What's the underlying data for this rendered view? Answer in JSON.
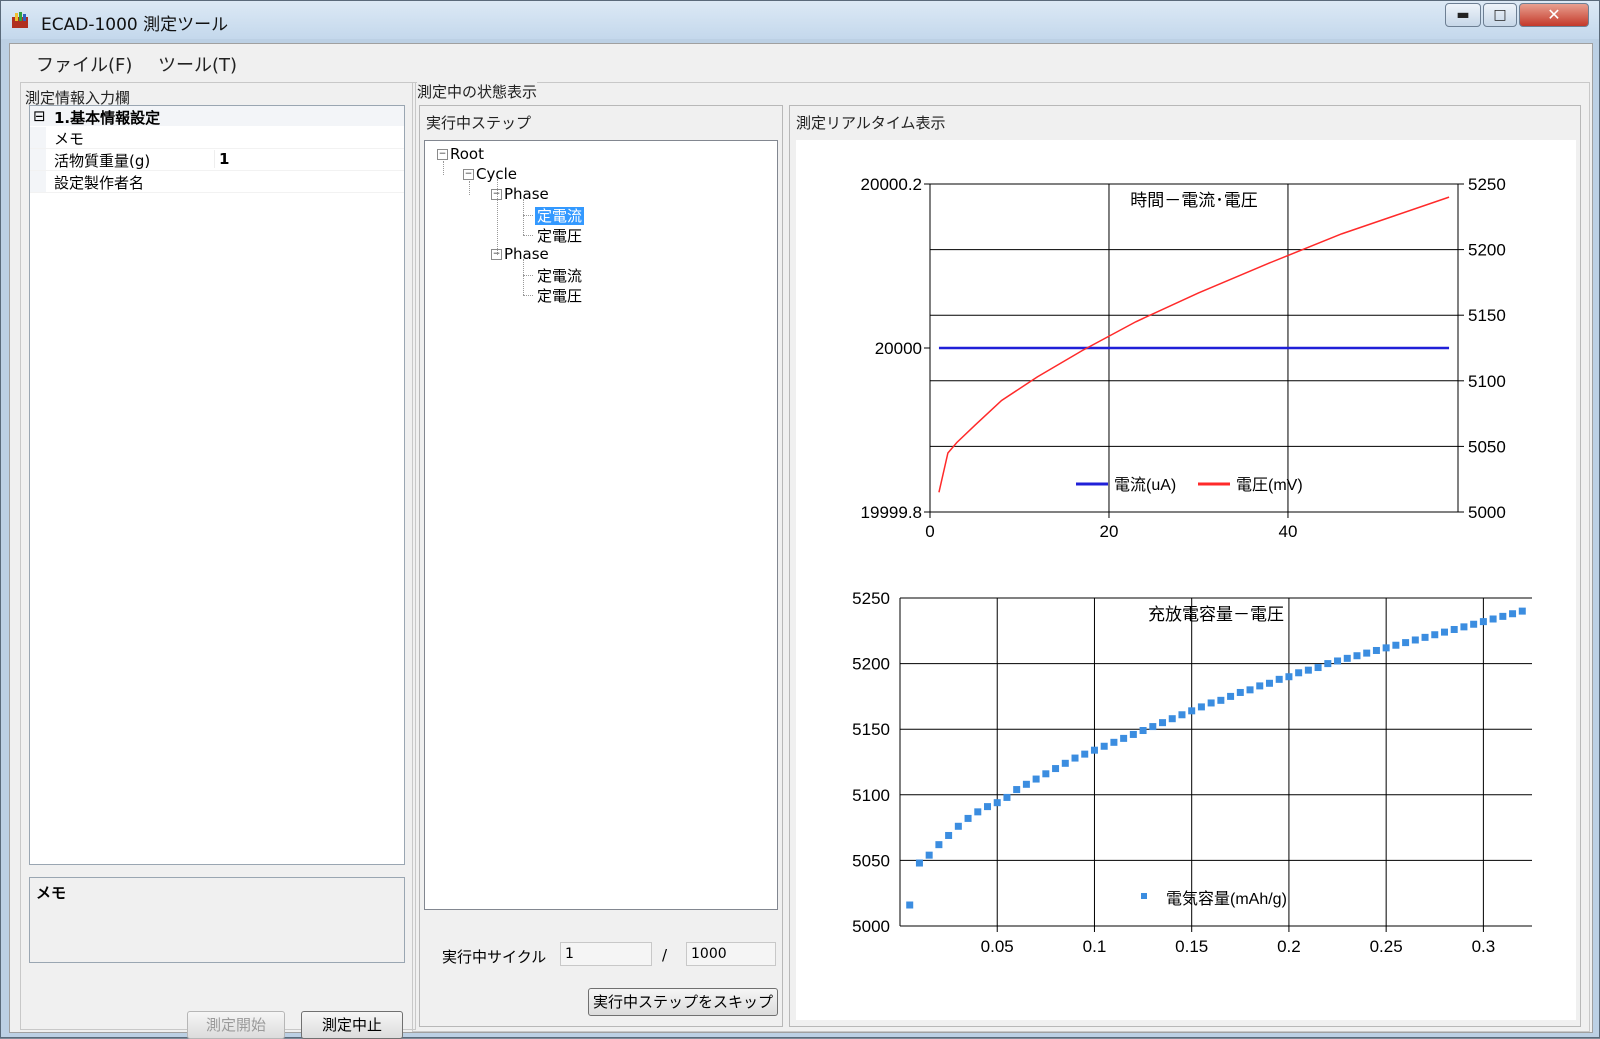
{
  "window": {
    "title": "ECAD-1000 測定ツール",
    "min_glyph": "▬",
    "max_glyph": "□",
    "close_glyph": "✕"
  },
  "menu": {
    "file": "ファイル(F)",
    "tool": "ツール(T)"
  },
  "left": {
    "group_title": "測定情報入力欄",
    "category_toggle": "⊟",
    "category": "1.基本情報設定",
    "props": [
      {
        "name": "メモ",
        "value": ""
      },
      {
        "name": "活物質重量(g)",
        "value": "1"
      },
      {
        "name": "設定製作者名",
        "value": ""
      }
    ],
    "memo_label": "メモ",
    "start_button": "測定開始",
    "stop_button": "測定中止"
  },
  "status": {
    "group_title": "測定中の状態表示",
    "step_title": "実行中ステップ",
    "tree": {
      "root": "Root",
      "cycle": "Cycle",
      "phase1": "Phase",
      "phase1_items": [
        "定電流",
        "定電圧"
      ],
      "phase2": "Phase",
      "phase2_items": [
        "定電流",
        "定電圧"
      ],
      "toggle": "−"
    },
    "cycle_label": "実行中サイクル",
    "cycle_current": "1",
    "cycle_sep": "/",
    "cycle_total": "1000",
    "skip_button": "実行中ステップをスキップ"
  },
  "realtime": {
    "title": "測定リアルタイム表示"
  },
  "chart_data": [
    {
      "type": "line",
      "title": "時間－電流･電圧",
      "x_ticks": [
        "0",
        "20",
        "40"
      ],
      "xlim": [
        0,
        59
      ],
      "y_left_ticks": [
        "20000.2",
        "20000",
        "19999.8"
      ],
      "ylim_left": [
        19999.8,
        20000.2
      ],
      "y_right_ticks": [
        "5250",
        "5200",
        "5150",
        "5100",
        "5050",
        "5000"
      ],
      "ylim_right": [
        5000,
        5250
      ],
      "grid": true,
      "legend_position": "bottom-center",
      "series": [
        {
          "name": "電流(uA)",
          "axis": "left",
          "color": "#2020d8",
          "x": [
            1,
            58
          ],
          "y": [
            20000,
            20000
          ]
        },
        {
          "name": "電圧(mV)",
          "axis": "right",
          "color": "#ff2a2a",
          "x": [
            1,
            2,
            3,
            5,
            8,
            12,
            17,
            23,
            30,
            38,
            46,
            52,
            58
          ],
          "y": [
            5015,
            5045,
            5053,
            5066,
            5085,
            5103,
            5123,
            5145,
            5167,
            5190,
            5212,
            5226,
            5240
          ]
        }
      ]
    },
    {
      "type": "scatter",
      "title": "充放電容量－電圧",
      "x_ticks": [
        "0.05",
        "0.1",
        "0.15",
        "0.2",
        "0.25",
        "0.3"
      ],
      "xlim": [
        0,
        0.325
      ],
      "y_ticks": [
        "5250",
        "5200",
        "5150",
        "5100",
        "5050",
        "5000"
      ],
      "ylim": [
        5000,
        5250
      ],
      "grid": true,
      "legend_position": "bottom-center",
      "series": [
        {
          "name": "電気容量(mAh/g)",
          "color": "#3b8de0",
          "x": [
            0.005,
            0.01,
            0.015,
            0.02,
            0.025,
            0.03,
            0.035,
            0.04,
            0.045,
            0.05,
            0.055,
            0.06,
            0.065,
            0.07,
            0.075,
            0.08,
            0.085,
            0.09,
            0.095,
            0.1,
            0.105,
            0.11,
            0.115,
            0.12,
            0.125,
            0.13,
            0.135,
            0.14,
            0.145,
            0.15,
            0.155,
            0.16,
            0.165,
            0.17,
            0.175,
            0.18,
            0.185,
            0.19,
            0.195,
            0.2,
            0.205,
            0.21,
            0.215,
            0.22,
            0.225,
            0.23,
            0.235,
            0.24,
            0.245,
            0.25,
            0.255,
            0.26,
            0.265,
            0.27,
            0.275,
            0.28,
            0.285,
            0.29,
            0.295,
            0.3,
            0.305,
            0.31,
            0.315,
            0.32
          ],
          "y": [
            5016,
            5048,
            5054,
            5062,
            5069,
            5076,
            5082,
            5087,
            5091,
            5094,
            5098,
            5104,
            5108,
            5112,
            5116,
            5120,
            5124,
            5128,
            5131,
            5134,
            5137,
            5140,
            5143,
            5146,
            5149,
            5152,
            5155,
            5158,
            5161,
            5164,
            5167,
            5170,
            5172,
            5175,
            5178,
            5180,
            5183,
            5185,
            5188,
            5190,
            5193,
            5195,
            5197,
            5200,
            5202,
            5204,
            5206,
            5208,
            5210,
            5212,
            5214,
            5216,
            5218,
            5220,
            5222,
            5224,
            5226,
            5228,
            5230,
            5232,
            5234,
            5236,
            5238,
            5240
          ]
        }
      ]
    }
  ]
}
